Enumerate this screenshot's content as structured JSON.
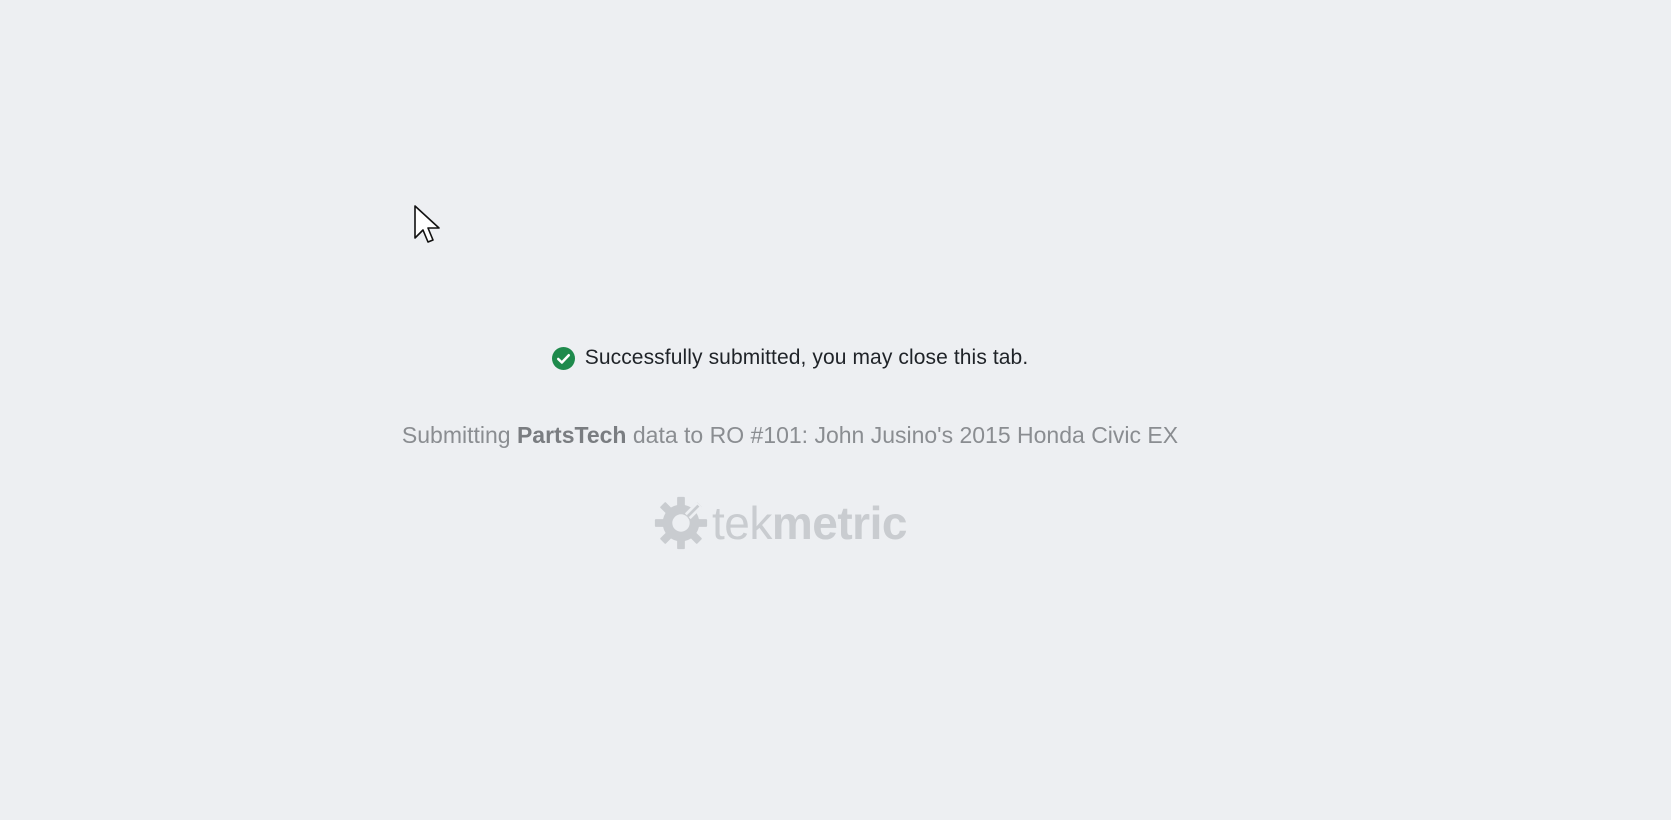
{
  "status": {
    "message": "Successfully submitted, you may close this tab.",
    "icon": "check-circle-icon",
    "icon_color": "#1e8a4c"
  },
  "detail": {
    "prefix": "Submitting ",
    "source": "PartsTech",
    "suffix": " data to RO #101: John Jusino's 2015 Honda Civic EX"
  },
  "logo": {
    "icon": "tekmetric-gear-icon",
    "text_light": "tek",
    "text_bold": "metric"
  },
  "colors": {
    "background": "#edeff2",
    "success": "#1e8a4c"
  }
}
